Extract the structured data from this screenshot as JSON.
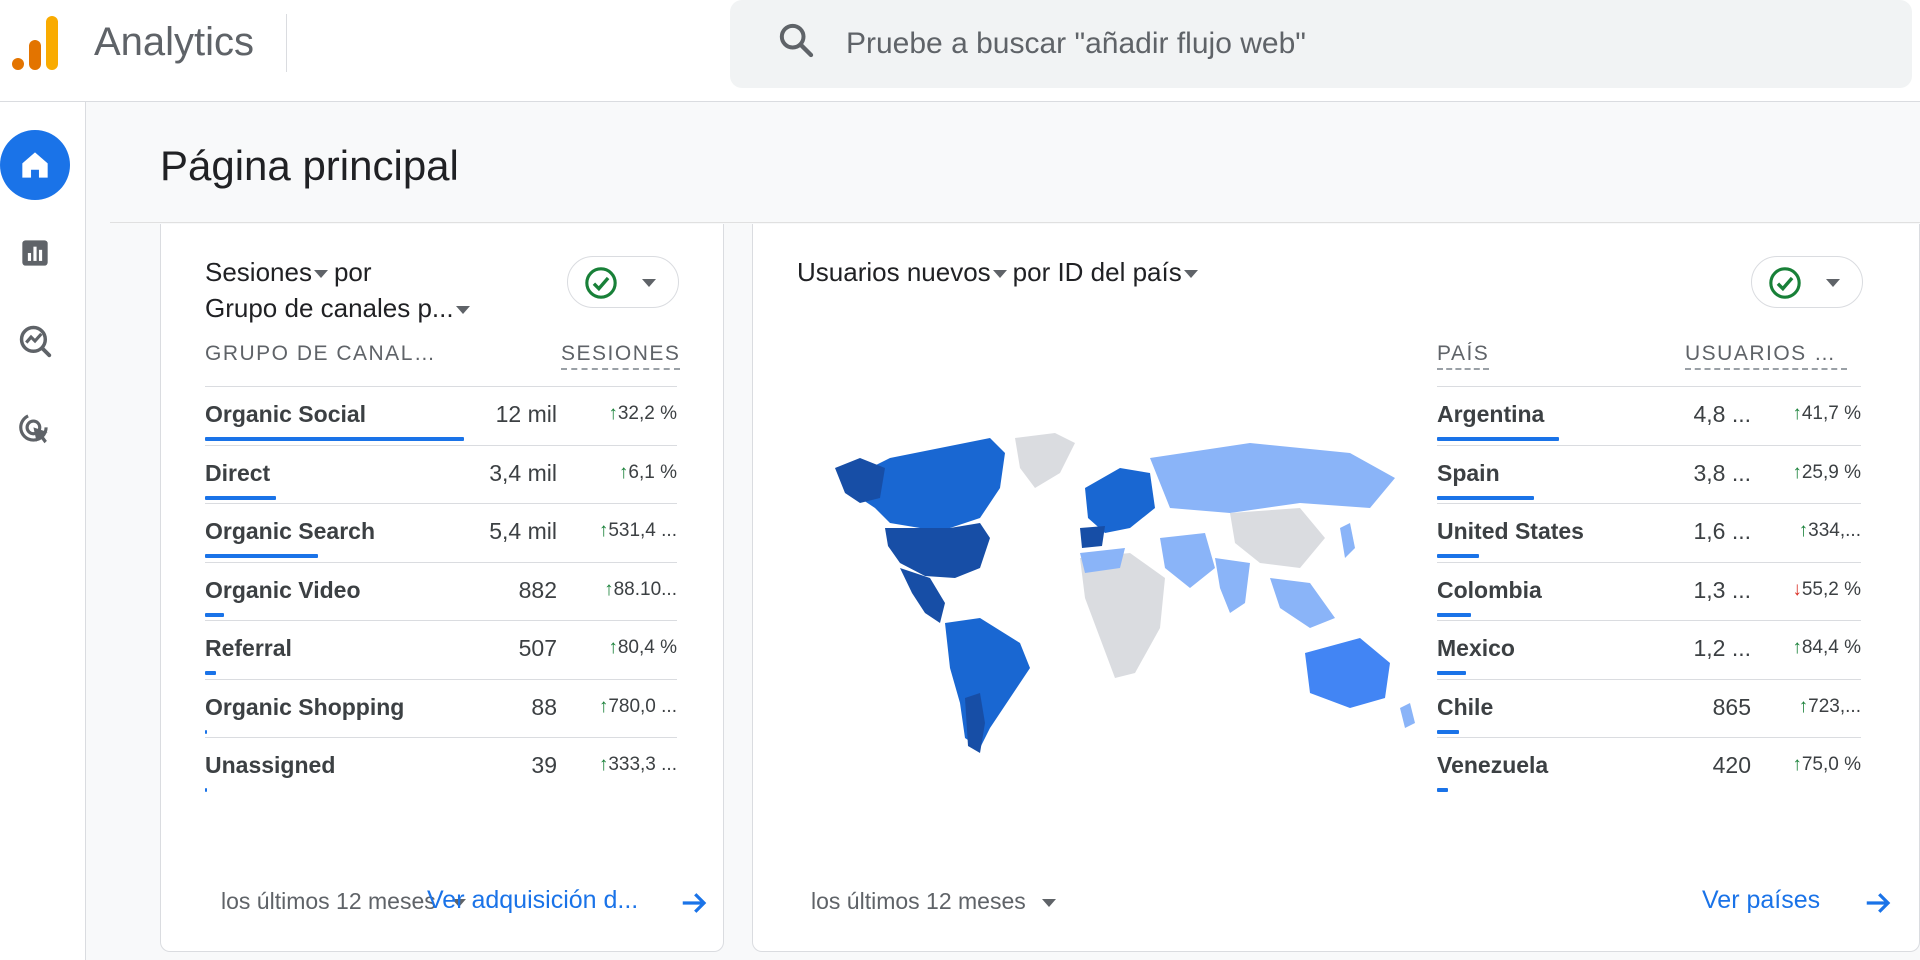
{
  "app": {
    "title": "Analytics"
  },
  "search": {
    "placeholder": "Pruebe a buscar \"añadir flujo web\""
  },
  "colors": {
    "accent": "#1a73e8",
    "positive": "#188038",
    "negative": "#d93025",
    "logo_orange": "#f9ab00",
    "logo_dark_orange": "#e37400"
  },
  "sidebar": {
    "items": [
      {
        "icon": "home-icon",
        "active": true
      },
      {
        "icon": "reports-icon",
        "active": false
      },
      {
        "icon": "explore-icon",
        "active": false
      },
      {
        "icon": "advertising-icon",
        "active": false
      }
    ]
  },
  "page": {
    "title": "Página principal"
  },
  "channels_card": {
    "metric": "Sesiones",
    "by": "por",
    "dimension": "Grupo de canales p...",
    "col_dimension": "GRUPO DE CANALE...",
    "col_metric": "SESIONES",
    "rows": [
      {
        "label": "Organic Social",
        "value": "12 mil",
        "change": "32,2 %",
        "direction": "up",
        "share": 0.55
      },
      {
        "label": "Direct",
        "value": "3,4 mil",
        "change": "6,1 %",
        "direction": "up",
        "share": 0.15
      },
      {
        "label": "Organic Search",
        "value": "5,4 mil",
        "change": "531,4 ...",
        "direction": "up",
        "share": 0.24
      },
      {
        "label": "Organic Video",
        "value": "882",
        "change": "88.10...",
        "direction": "up",
        "share": 0.04
      },
      {
        "label": "Referral",
        "value": "507",
        "change": "80,4 %",
        "direction": "up",
        "share": 0.023
      },
      {
        "label": "Organic Shopping",
        "value": "88",
        "change": "780,0 ...",
        "direction": "up",
        "share": 0.004
      },
      {
        "label": "Unassigned",
        "value": "39",
        "change": "333,3 ...",
        "direction": "up",
        "share": 0.002
      }
    ],
    "date_range": "los últimos 12 meses",
    "link": "Ver adquisición d..."
  },
  "country_card": {
    "metric": "Usuarios nuevos",
    "dimension": "por ID del país",
    "col_dimension": "PAÍS",
    "col_metric": "USUARIOS N...",
    "rows": [
      {
        "label": "Argentina",
        "value": "4,8 ...",
        "change": "41,7 %",
        "direction": "up",
        "share": 0.29
      },
      {
        "label": "Spain",
        "value": "3,8 ...",
        "change": "25,9 %",
        "direction": "up",
        "share": 0.23
      },
      {
        "label": "United States",
        "value": "1,6 ...",
        "change": "334,...",
        "direction": "up",
        "share": 0.1
      },
      {
        "label": "Colombia",
        "value": "1,3 ...",
        "change": "55,2 %",
        "direction": "down",
        "share": 0.08
      },
      {
        "label": "Mexico",
        "value": "1,2 ...",
        "change": "84,4 %",
        "direction": "up",
        "share": 0.07
      },
      {
        "label": "Chile",
        "value": "865",
        "change": "723,...",
        "direction": "up",
        "share": 0.052
      },
      {
        "label": "Venezuela",
        "value": "420",
        "change": "75,0 %",
        "direction": "up",
        "share": 0.025
      }
    ],
    "date_range": "los últimos 12 meses",
    "link": "Ver países"
  }
}
